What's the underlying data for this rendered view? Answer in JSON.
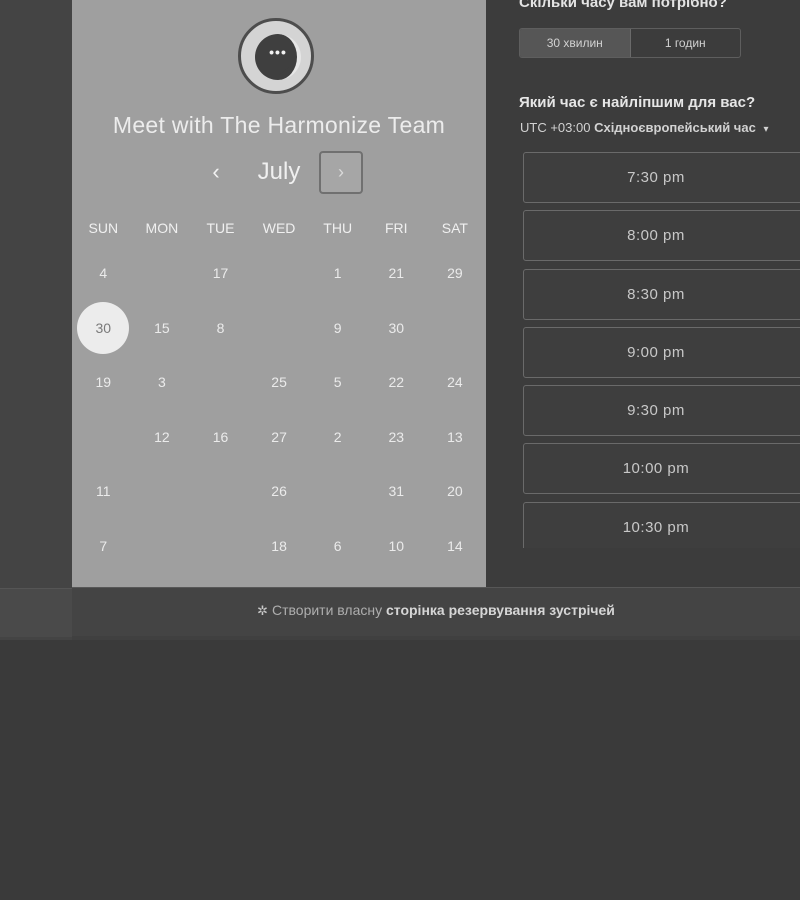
{
  "calendar": {
    "title": "Meet with The Harmonize Team",
    "month": "July",
    "prev_symbol": "‹",
    "next_symbol": "›",
    "weekdays": [
      "SUN",
      "MON",
      "TUE",
      "WED",
      "THU",
      "FRI",
      "SAT"
    ],
    "weeks": [
      [
        "4",
        "",
        "17",
        "",
        "1",
        "21",
        "29"
      ],
      [
        "30",
        "15",
        "8",
        "",
        "9",
        "30",
        ""
      ],
      [
        "19",
        "3",
        "",
        "25",
        "5",
        "22",
        "24"
      ],
      [
        "",
        "12",
        "16",
        "27",
        "2",
        "23",
        "13"
      ],
      [
        "11",
        "",
        "",
        "26",
        "",
        "31",
        "20"
      ],
      [
        "7",
        "",
        "",
        "18",
        "6",
        "10",
        "14"
      ]
    ],
    "selected": "30",
    "avatar_dots": "•••"
  },
  "booking": {
    "duration_question": "Скільки часу вам потрібно?",
    "durations": [
      "30 хвилин",
      "1 годин"
    ],
    "active_duration": "30 хвилин",
    "time_question": "Який час є найліпшим для вас?",
    "timezone_prefix": "UTC +03:00",
    "timezone_name": "Східноєвропейський час",
    "slots": [
      "7:30 pm",
      "8:00 pm",
      "8:30 pm",
      "9:00 pm",
      "9:30 pm",
      "10:00 pm",
      "10:30 pm"
    ]
  },
  "footer": {
    "prefix": "Створити власну",
    "link": "сторінка резервування зустрічей"
  },
  "icons": {
    "sprocket": "✲",
    "caret": "▾"
  }
}
